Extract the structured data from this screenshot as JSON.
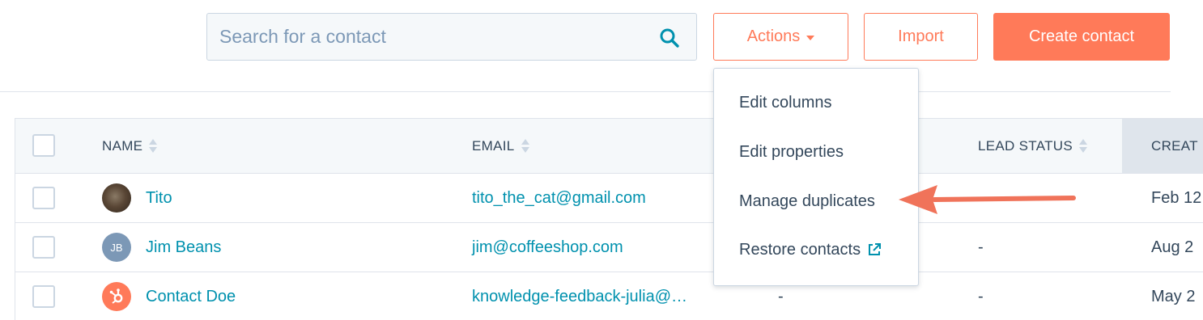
{
  "toolbar": {
    "search_placeholder": "Search for a contact",
    "actions_label": "Actions",
    "import_label": "Import",
    "create_label": "Create contact"
  },
  "table": {
    "columns": [
      "NAME",
      "EMAIL",
      "LEAD STATUS",
      "CREAT"
    ],
    "rows": [
      {
        "avatar": "photo",
        "initials": "",
        "name": "Tito",
        "email": "tito_the_cat@gmail.com",
        "phone": "",
        "lead_status": "",
        "created": "Feb 12"
      },
      {
        "avatar": "initials",
        "initials": "JB",
        "name": "Jim Beans",
        "email": "jim@coffeeshop.com",
        "phone": "",
        "lead_status": "-",
        "created": "Aug 2"
      },
      {
        "avatar": "hubspot-logo",
        "initials": "",
        "name": "Contact Doe",
        "email": "knowledge-feedback-julia@…",
        "phone": "-",
        "lead_status": "-",
        "created": "May 2"
      }
    ]
  },
  "actions_menu": {
    "items": [
      "Edit columns",
      "Edit properties",
      "Manage duplicates",
      "Restore contacts"
    ],
    "highlighted": "Manage duplicates",
    "external_link_icon": "external-link-icon"
  },
  "colors": {
    "accent": "#ff7a59",
    "link": "#0091ae",
    "text": "#33475b",
    "border": "#cbd6e2",
    "header_bg": "#f5f8fa"
  }
}
